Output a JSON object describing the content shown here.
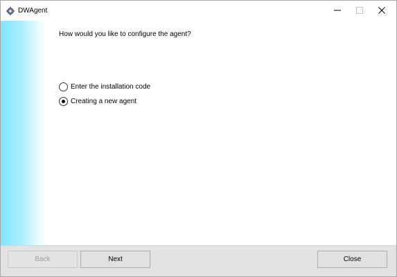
{
  "window": {
    "title": "DWAgent",
    "app_icon": "gear-icon",
    "controls": {
      "minimize_icon": "minimize-icon",
      "maximize_icon": "maximize-icon",
      "close_icon": "close-icon"
    }
  },
  "main": {
    "question": "How would you like to configure the agent?",
    "options": [
      {
        "label": "Enter the installation code",
        "selected": false
      },
      {
        "label": "Creating a new agent",
        "selected": true
      }
    ]
  },
  "footer": {
    "back_label": "Back",
    "back_enabled": false,
    "next_label": "Next",
    "close_label": "Close"
  },
  "colors": {
    "side_accent": "#7fe6ff",
    "footer_bg": "#e3e3e3",
    "button_bg": "#e1e1e1",
    "disabled_text": "#a0a0a0"
  }
}
